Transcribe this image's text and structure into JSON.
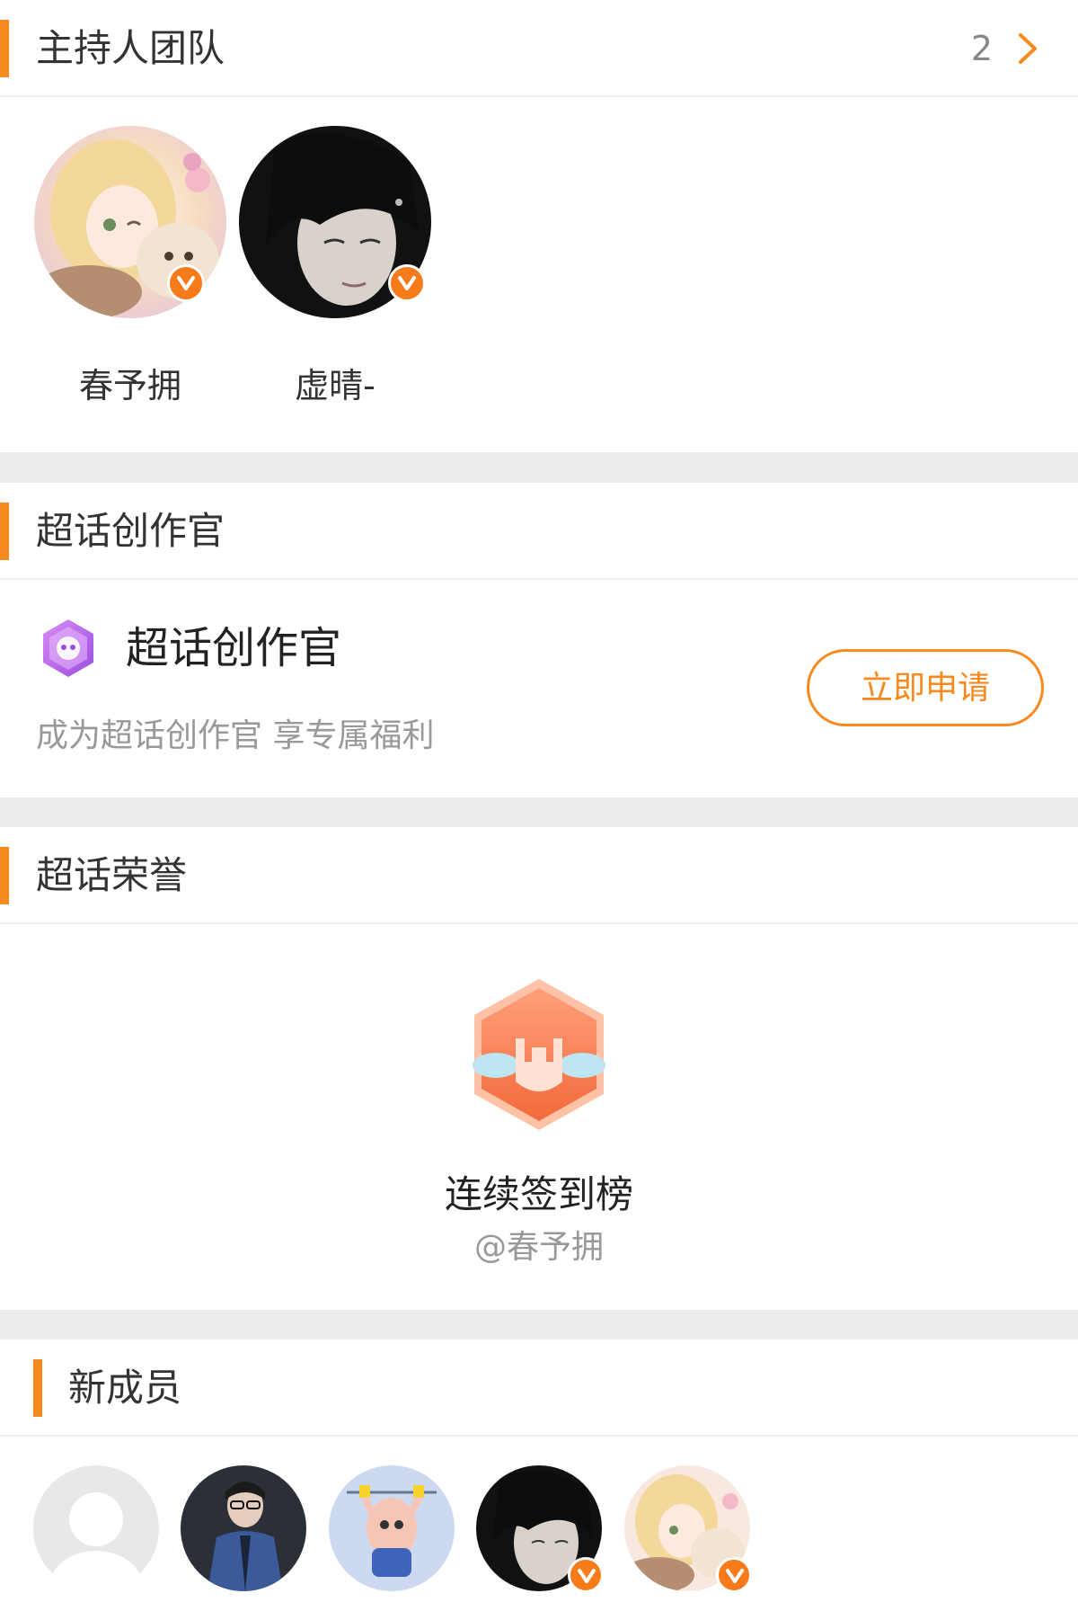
{
  "host_team": {
    "title": "主持人团队",
    "count": "2",
    "hosts": [
      {
        "name": "春予拥",
        "verified": true
      },
      {
        "name": "虚晴-",
        "verified": true
      }
    ]
  },
  "creator": {
    "section_title": "超话创作官",
    "title": "超话创作官",
    "subtitle": "成为超话创作官 享专属福利",
    "apply_label": "立即申请"
  },
  "honor": {
    "section_title": "超话荣誉",
    "badge_title": "连续签到榜",
    "badge_user": "@春予拥"
  },
  "new_members": {
    "title": "新成员"
  },
  "colors": {
    "accent": "#f78a1e",
    "verified_badge": "#f77b1b",
    "divider": "#ececec"
  }
}
